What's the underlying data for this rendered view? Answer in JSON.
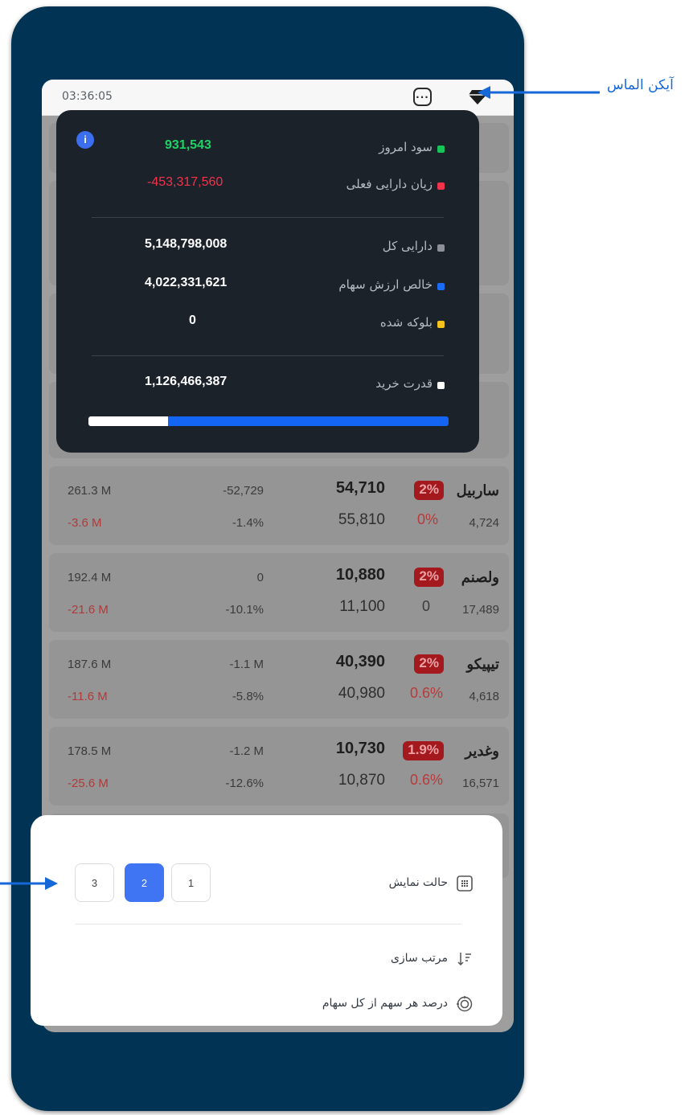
{
  "status_bar": {
    "time": "03:36:05",
    "more_icon": "more-horizontal-icon",
    "diamond_icon": "diamond-icon"
  },
  "summary": {
    "info_icon": "i",
    "rows": [
      {
        "label": "سود امروز",
        "value": "931,543",
        "dot_color": "#16c55a",
        "value_color": "#1fd266"
      },
      {
        "label": "زیان دارایی فعلی",
        "value": "-453,317,560",
        "dot_color": "#f2334b",
        "value_color": "#f2334b"
      },
      {
        "label": "دارایی کل",
        "value": "5,148,798,008",
        "dot_color": "#8b9099",
        "value_color": "#ffffff"
      },
      {
        "label": "خالص ارزش سهام",
        "value": "4,022,331,621",
        "dot_color": "#1a6cf5",
        "value_color": "#ffffff"
      },
      {
        "label": "بلوکه شده",
        "value": "0",
        "dot_color": "#f6c21c",
        "value_color": "#ffffff"
      },
      {
        "label": "قدرت خرید",
        "value": "1,126,466,387",
        "dot_color": "#ffffff",
        "value_color": "#ffffff"
      }
    ],
    "buying_power_fraction": 0.22
  },
  "stocks": [
    {
      "symbol": "ساربیل",
      "count": "4,724",
      "price": "54,710",
      "badge": "2%",
      "price2": "55,810",
      "pct2": "0%",
      "change": "-52,729",
      "change_pct": "-1.4%",
      "volume": "261.3 M",
      "pl": "-3.6 M"
    },
    {
      "symbol": "ولصنم",
      "count": "17,489",
      "price": "10,880",
      "badge": "2%",
      "price2": "11,100",
      "pct2": "0",
      "change": "0",
      "change_pct": "-10.1%",
      "volume": "192.4 M",
      "pl": "-21.6 M"
    },
    {
      "symbol": "تیپیکو",
      "count": "4,618",
      "price": "40,390",
      "badge": "2%",
      "price2": "40,980",
      "pct2": "0.6%",
      "change": "-1.1 M",
      "change_pct": "-5.8%",
      "volume": "187.6 M",
      "pl": "-11.6 M"
    },
    {
      "symbol": "وغدیر",
      "count": "16,571",
      "price": "10,730",
      "badge": "1.9%",
      "price2": "10,870",
      "pct2": "0.6%",
      "change": "-1.2 M",
      "change_pct": "-12.6%",
      "volume": "178.5 M",
      "pl": "-25.6 M"
    }
  ],
  "sheet": {
    "display_mode": {
      "label": "حالت نمایش",
      "icon": "grid-icon",
      "options": [
        "3",
        "2",
        "1"
      ],
      "selected": "2"
    },
    "sort": {
      "label": "مرتب سازی",
      "icon": "sort-icon"
    },
    "percentage": {
      "label": "درصد هر سهم از کل سهام",
      "icon": "target-icon"
    }
  },
  "annotations": {
    "diamond_label": "آیکن الماس",
    "arrow_color": "#1667d7"
  }
}
